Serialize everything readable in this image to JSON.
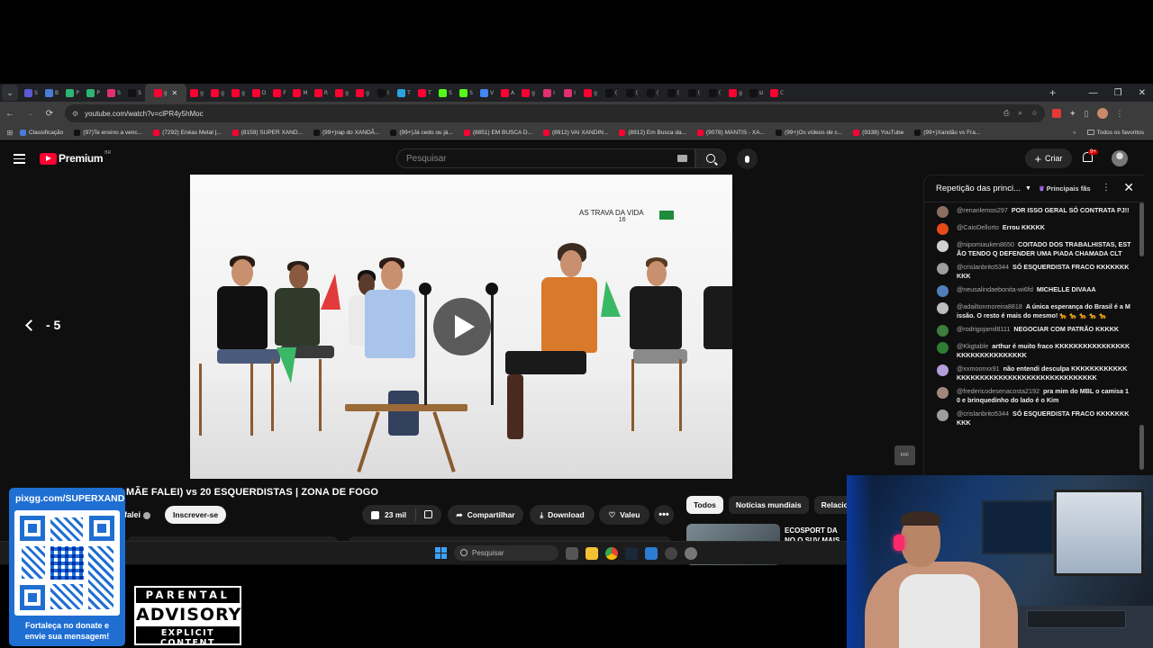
{
  "browser": {
    "tabs": [
      {
        "glyph": "S",
        "color": "#5b5bd6"
      },
      {
        "glyph": "B",
        "color": "#4a7bd8"
      },
      {
        "glyph": "P",
        "color": "#2bb673"
      },
      {
        "glyph": "P",
        "color": "#2bb673"
      },
      {
        "glyph": "S",
        "color": "#e1306c"
      },
      {
        "glyph": "S",
        "color": "#111111"
      },
      {
        "glyph": "g",
        "color": "#ff0033",
        "active": true
      },
      {
        "glyph": "g",
        "color": "#ff0033"
      },
      {
        "glyph": "g",
        "color": "#ff0033"
      },
      {
        "glyph": "g",
        "color": "#ff0033"
      },
      {
        "glyph": "D",
        "color": "#ff0033"
      },
      {
        "glyph": "F",
        "color": "#ff0033"
      },
      {
        "glyph": "M",
        "color": "#ff0033"
      },
      {
        "glyph": "R",
        "color": "#ff0033"
      },
      {
        "glyph": "g",
        "color": "#ff0033"
      },
      {
        "glyph": "g",
        "color": "#ff0033"
      },
      {
        "glyph": "I",
        "color": "#111111"
      },
      {
        "glyph": "T",
        "color": "#2aa3e0"
      },
      {
        "glyph": "T",
        "color": "#ff0033"
      },
      {
        "glyph": "S",
        "color": "#53fc18"
      },
      {
        "glyph": "S",
        "color": "#53fc18"
      },
      {
        "glyph": "V",
        "color": "#4285f4"
      },
      {
        "glyph": "A",
        "color": "#ff0033"
      },
      {
        "glyph": "g",
        "color": "#ff0033"
      },
      {
        "glyph": "I",
        "color": "#e1306c"
      },
      {
        "glyph": "I",
        "color": "#e1306c"
      },
      {
        "glyph": "g",
        "color": "#ff0033"
      },
      {
        "glyph": "(",
        "color": "#111111"
      },
      {
        "glyph": "(",
        "color": "#111111"
      },
      {
        "glyph": "(",
        "color": "#111111"
      },
      {
        "glyph": "(",
        "color": "#111111"
      },
      {
        "glyph": "(",
        "color": "#111111"
      },
      {
        "glyph": "(",
        "color": "#111111"
      },
      {
        "glyph": "g",
        "color": "#ff0033"
      },
      {
        "glyph": "si",
        "color": "#111111"
      },
      {
        "glyph": "C",
        "color": "#ff0033"
      }
    ],
    "url": "youtube.com/watch?v=clPR4y5hMoc",
    "bookmarks": [
      {
        "label": "Classificação",
        "color": "#4a7bd8"
      },
      {
        "label": "(97)Te ensino a venc...",
        "color": "#111111"
      },
      {
        "label": "(7292) Enéas Metal |...",
        "color": "#ff0033"
      },
      {
        "label": "(8159) SUPER XAND...",
        "color": "#ff0033"
      },
      {
        "label": "(99+)rap do XANDÃ...",
        "color": "#111111"
      },
      {
        "label": "(99+)Já cedo ou já...",
        "color": "#111111"
      },
      {
        "label": "(8851) EM BUSCA D...",
        "color": "#ff0033"
      },
      {
        "label": "(8912) VAI XANDIN...",
        "color": "#ff0033"
      },
      {
        "label": "(8912) Em Busca da...",
        "color": "#ff0033"
      },
      {
        "label": "(9078) MANTIS - XA...",
        "color": "#ff0033"
      },
      {
        "label": "(99+)Os vídeos de c...",
        "color": "#111111"
      },
      {
        "label": "(9338) YouTube",
        "color": "#ff0033"
      },
      {
        "label": "(99+)Xandão vs Fra...",
        "color": "#111111"
      }
    ],
    "bookmarks_more": "»",
    "all_favorites": "Todos os favoritos"
  },
  "youtube": {
    "logo_text": "Premium",
    "logo_region": "BR",
    "search_placeholder": "Pesquisar",
    "create_label": "Criar",
    "notif_count": "9+",
    "video_overlay_title": "AS TRAVA DA VIDA",
    "video_overlay_number": "16",
    "rewind_label": "- 5",
    "video_title": "MÃE FALEI) vs 20 ESQUERDISTAS | ZONA DE FOGO",
    "channel_name": "falei",
    "subscribe_label": "Inscrever-se",
    "like_count": "23 mil",
    "share_label": "Compartilhar",
    "download_label": "Download",
    "thanks_label": "Valeu",
    "more_label": "•••",
    "chips": [
      "Todos",
      "Notícias mundiais",
      "Relaciona"
    ],
    "rec_title": "ECOSPORT DA NO O SUV MAIS BAR"
  },
  "chat": {
    "title": "Repetição das princi...",
    "filter_label": "Principais fãs",
    "messages": [
      {
        "author": "@renanlemos297",
        "text": "POR ISSO GERAL SÓ CONTRATA PJ!!",
        "color": "#8d6e63"
      },
      {
        "author": "@CaioDellorto",
        "text": "Errou KKKKK",
        "color": "#e64a19"
      },
      {
        "author": "@nipomiauken8650",
        "text": "COITADO DOS TRABALHISTAS, ESTÃO TENDO Q DEFENDER UMA PIADA CHAMADA CLT",
        "color": "#d0d0d0"
      },
      {
        "author": "@crislanbrito5344",
        "text": "SÓ ESQUERDISTA FRACO KKKKKKKKKK",
        "color": "#9e9e9e"
      },
      {
        "author": "@neusalindaebonita-wi6fd",
        "text": "MICHELLE DIVAAA",
        "color": "#4f7fb8"
      },
      {
        "author": "@adailtonmoreira8818",
        "text": "A única esperança do Brasil é a Missão. O resto é mais do mesmo! 🐆 🐆 🐆 🐆 🐆",
        "color": "#bdbdbd"
      },
      {
        "author": "@rodrigojamil8111",
        "text": "NEGOCIAR COM PATRÃO KKKKK",
        "color": "#3e7d3e"
      },
      {
        "author": "@Kkgtable",
        "text": "arthur é muito fraco KKKKKKKKKKKKKKKKKKKKKKKKKKKKKKK",
        "color": "#2e7d32"
      },
      {
        "author": "@xxmoonxx91",
        "text": "não entendi desculpa KKKKKKKKKKKKKKKKKKKKKKKKKKKKKKKKKKKKKKKKKK",
        "color": "#b39ddb"
      },
      {
        "author": "@fredericodesenacosta2192",
        "text": "pra mim do MBL o camisa 10 e brinquedinho do lado é o Kim",
        "color": "#a1887f"
      },
      {
        "author": "@crislanbrito5344",
        "text": "SÓ ESQUERDISTA FRACO KKKKKKKKKK",
        "color": "#9e9e9e"
      }
    ]
  },
  "taskbar": {
    "search_placeholder": "Pesquisar"
  },
  "overlay": {
    "donate_url": "pixgg.com/SUPERXAND",
    "donate_message_line1": "Fortaleça no donate e",
    "donate_message_line2": "envie sua mensagem!",
    "advisory_line1": "PARENTAL",
    "advisory_line2": "ADVISORY",
    "advisory_line3": "EXPLICIT CONTENT"
  }
}
